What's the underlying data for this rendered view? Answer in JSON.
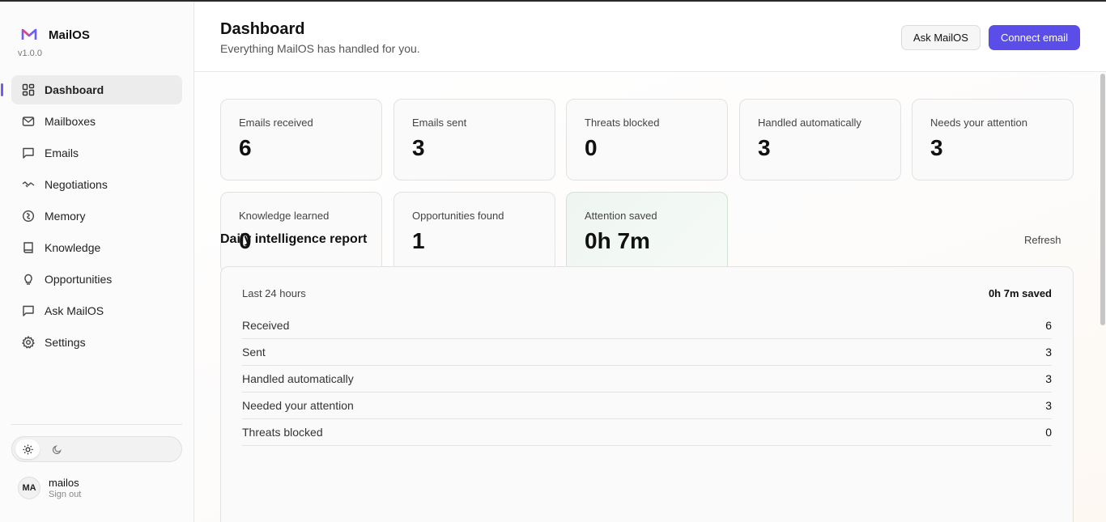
{
  "app": {
    "name": "MailOS",
    "version": "v1.0.0"
  },
  "sidebar": {
    "items": [
      {
        "label": "Dashboard",
        "icon": "grid-icon"
      },
      {
        "label": "Mailboxes",
        "icon": "mail-icon"
      },
      {
        "label": "Emails",
        "icon": "message-square-icon"
      },
      {
        "label": "Negotiations",
        "icon": "handshake-icon"
      },
      {
        "label": "Memory",
        "icon": "brain-icon"
      },
      {
        "label": "Knowledge",
        "icon": "book-icon"
      },
      {
        "label": "Opportunities",
        "icon": "lightbulb-icon"
      },
      {
        "label": "Ask MailOS",
        "icon": "message-square-icon"
      },
      {
        "label": "Settings",
        "icon": "gear-icon"
      }
    ],
    "active": "Dashboard",
    "theme": {
      "selected": "light",
      "options": [
        "sun-icon",
        "moon-icon"
      ]
    },
    "user": {
      "initials": "MA",
      "name": "mailos",
      "sign_out": "Sign out"
    }
  },
  "header": {
    "title": "Dashboard",
    "subtitle": "Everything MailOS has handled for you.",
    "ask_button": "Ask MailOS",
    "connect_button": "Connect email"
  },
  "stats": [
    {
      "label": "Emails received",
      "value": "6"
    },
    {
      "label": "Emails sent",
      "value": "3"
    },
    {
      "label": "Threats blocked",
      "value": "0"
    },
    {
      "label": "Handled automatically",
      "value": "3"
    },
    {
      "label": "Needs your attention",
      "value": "3"
    },
    {
      "label": "Knowledge learned",
      "value": "0"
    },
    {
      "label": "Opportunities found",
      "value": "1"
    },
    {
      "label": "Attention saved",
      "value": "0h 7m"
    }
  ],
  "report": {
    "title": "Daily intelligence report",
    "refresh": "Refresh",
    "period": "Last 24 hours",
    "saved": "0h 7m saved",
    "rows": [
      {
        "label": "Received",
        "value": "6"
      },
      {
        "label": "Sent",
        "value": "3"
      },
      {
        "label": "Handled automatically",
        "value": "3"
      },
      {
        "label": "Needed your attention",
        "value": "3"
      },
      {
        "label": "Threats blocked",
        "value": "0"
      }
    ]
  },
  "colors": {
    "accent": "#5b4ee8",
    "active_bar": "#6d5cf5",
    "saved_card": "#eef6f1"
  }
}
